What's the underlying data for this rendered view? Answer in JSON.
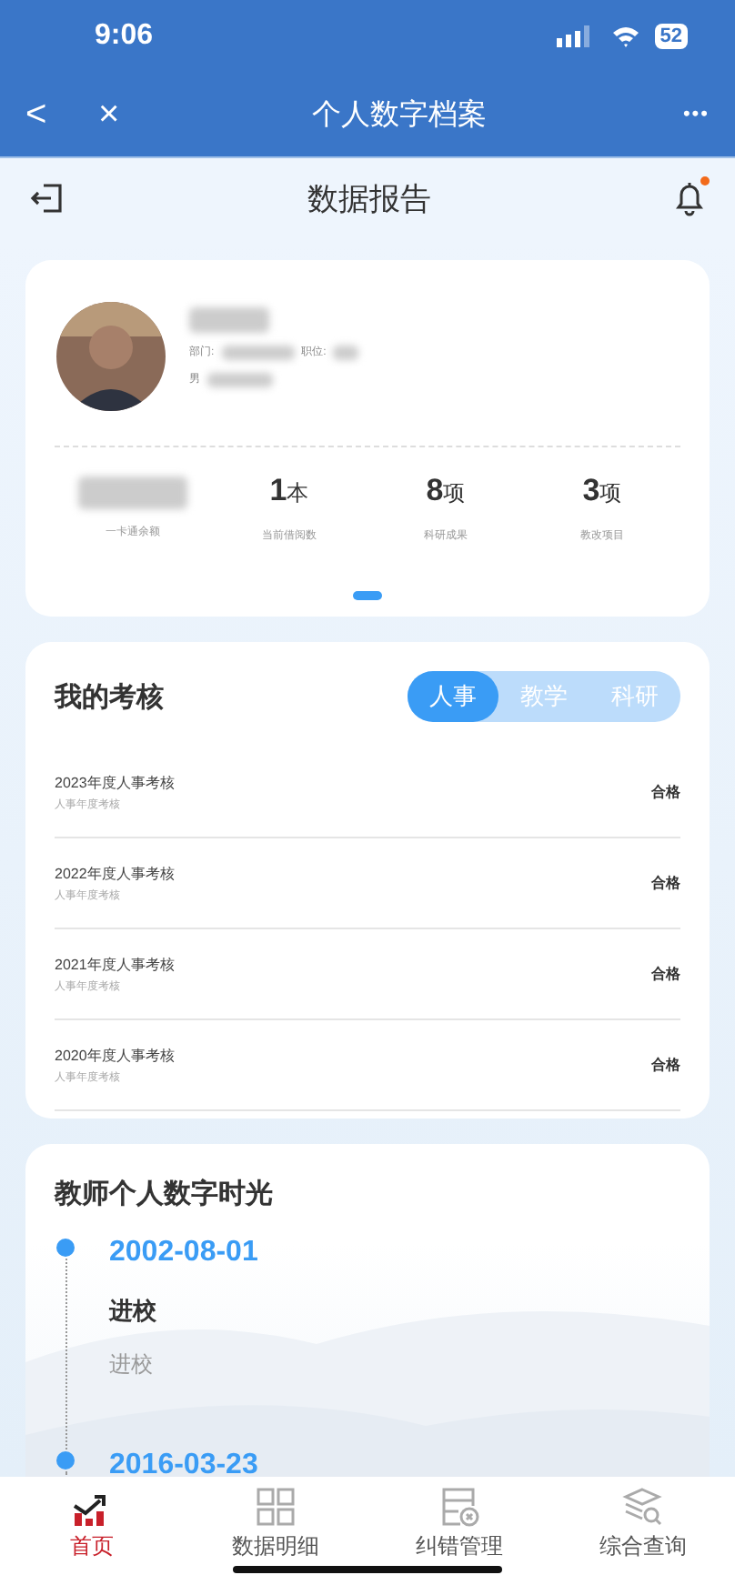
{
  "status_bar": {
    "time": "9:06",
    "battery": "52"
  },
  "nav_bar": {
    "title": "个人数字档案",
    "back": "<",
    "close": "×",
    "more": "•••"
  },
  "header": {
    "title": "数据报告",
    "has_unread": true
  },
  "profile": {
    "fields": [
      {
        "label": "部门:"
      },
      {
        "label": "职位:"
      },
      {
        "label": "男"
      }
    ],
    "stats": [
      {
        "label": "一卡通余额",
        "redacted": true
      },
      {
        "value": "1",
        "unit": "本",
        "label": "当前借阅数",
        "redacted": false
      },
      {
        "value": "8",
        "unit": "项",
        "label": "科研成果",
        "redacted": false
      },
      {
        "value": "3",
        "unit": "项",
        "label": "教改项目",
        "redacted": false
      }
    ]
  },
  "review": {
    "title": "我的考核",
    "tabs": [
      {
        "label": "人事",
        "selected": true
      },
      {
        "label": "教学",
        "selected": false
      },
      {
        "label": "科研",
        "selected": false
      }
    ],
    "rows": [
      {
        "name": "2023年度人事考核",
        "sub": "人事年度考核",
        "result": "合格"
      },
      {
        "name": "2022年度人事考核",
        "sub": "人事年度考核",
        "result": "合格"
      },
      {
        "name": "2021年度人事考核",
        "sub": "人事年度考核",
        "result": "合格"
      },
      {
        "name": "2020年度人事考核",
        "sub": "人事年度考核",
        "result": "合格"
      }
    ]
  },
  "timeline": {
    "title": "教师个人数字时光",
    "events": [
      {
        "date": "2002-08-01",
        "title": "进校",
        "desc": "进校"
      },
      {
        "date": "2016-03-23"
      }
    ]
  },
  "tab_bar": [
    {
      "label": "首页",
      "selected": true
    },
    {
      "label": "数据明细",
      "selected": false
    },
    {
      "label": "纠错管理",
      "selected": false
    },
    {
      "label": "综合查询",
      "selected": false
    }
  ]
}
